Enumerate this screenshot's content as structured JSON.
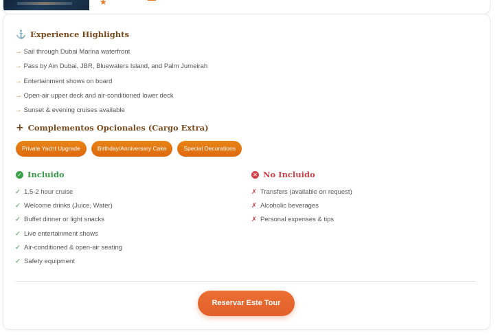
{
  "highlights": {
    "title": "Experience Highlights",
    "icon": "anchor-icon",
    "items": [
      "Sail through Dubai Marina waterfront",
      "Pass by Ain Dubai, JBR, Bluewaters Island, and Palm Jumeirah",
      "Entertainment shows on board",
      "Open-air upper deck and air-conditioned lower deck",
      "Sunset & evening cruises available"
    ]
  },
  "addons": {
    "title": "Complementos Opcionales (Cargo Extra)",
    "icon": "plus-icon",
    "chips": [
      "Private Yacht Upgrade",
      "Birthday/Anniversary Cake",
      "Special Decorations"
    ]
  },
  "included": {
    "title": "Incluido",
    "icon": "check-circle-icon",
    "items": [
      "1.5-2 hour cruise",
      "Welcome drinks (Juice, Water)",
      "Buffet dinner or light snacks",
      "Live entertainment shows",
      "Air-conditioned & open-air seating",
      "Safety equipment"
    ]
  },
  "excluded": {
    "title": "No Incluido",
    "icon": "x-circle-icon",
    "items": [
      "Transfers (available on request)",
      "Alcoholic beverages",
      "Personal expenses & tips"
    ]
  },
  "cta": {
    "label": "Reservar Este Tour"
  },
  "colors": {
    "accent": "#e2602a",
    "chip": "#e07812",
    "included": "#3a9a4a",
    "excluded": "#d2404a",
    "heading": "#7a4a1e"
  }
}
